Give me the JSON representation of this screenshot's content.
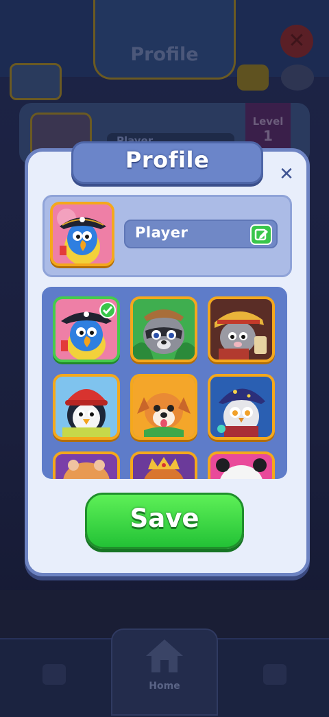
{
  "background": {
    "header_title": "Profile",
    "card_name": "Player",
    "level_label": "Level",
    "level_value": "1",
    "nav_home_label": "Home"
  },
  "modal": {
    "title": "Profile",
    "close_icon": "close-icon",
    "player_name": "Player",
    "edit_icon": "edit-icon",
    "save_label": "Save",
    "selected_avatar": "pirate-parrot",
    "avatars": [
      {
        "id": "pirate-parrot",
        "selected": true
      },
      {
        "id": "explorer-raccoon",
        "selected": false
      },
      {
        "id": "adventurer-cat",
        "selected": false
      },
      {
        "id": "winter-penguin",
        "selected": false
      },
      {
        "id": "happy-puppy",
        "selected": false
      },
      {
        "id": "wizard-owl",
        "selected": false
      },
      {
        "id": "hamster",
        "selected": false
      },
      {
        "id": "king-fox",
        "selected": false
      },
      {
        "id": "panda",
        "selected": false
      }
    ]
  },
  "colors": {
    "accent_gold": "#f4a81c",
    "selected_green": "#45cc4c",
    "save_green": "#23c236",
    "panel_blue": "#5e7cc9"
  }
}
